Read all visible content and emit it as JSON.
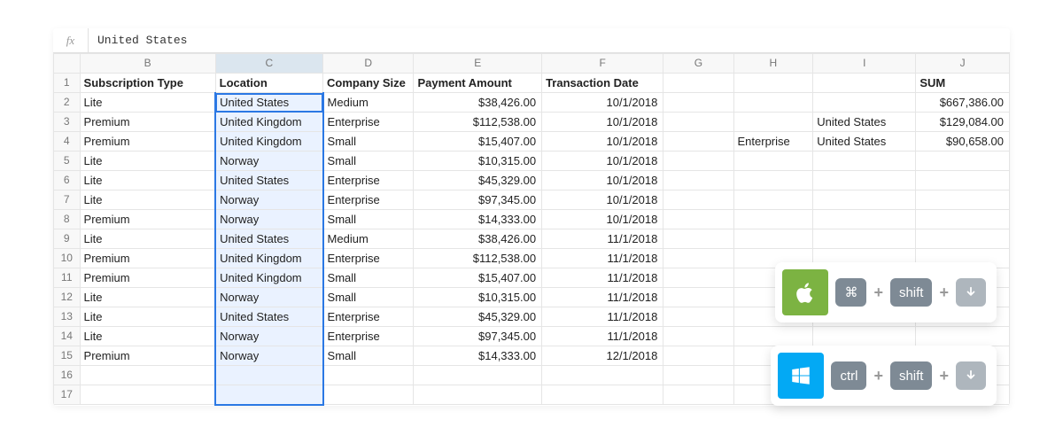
{
  "formula_bar": {
    "fx": "fx",
    "value": "United States"
  },
  "columns": [
    "B",
    "C",
    "D",
    "E",
    "F",
    "G",
    "H",
    "I",
    "J"
  ],
  "rownums": [
    "1",
    "2",
    "3",
    "4",
    "5",
    "6",
    "7",
    "8",
    "9",
    "10",
    "11",
    "12",
    "13",
    "14",
    "15",
    "16",
    "17"
  ],
  "headers": {
    "B": "Subscription Type",
    "C": "Location",
    "D": "Company Size",
    "E": "Payment Amount",
    "F": "Transaction Date",
    "G": "",
    "H": "",
    "I": "",
    "J": "SUM"
  },
  "rows": [
    {
      "B": "Lite",
      "C": "United States",
      "D": "Medium",
      "E": "$38,426.00",
      "F": "10/1/2018",
      "G": "",
      "H": "",
      "I": "",
      "J": "$667,386.00"
    },
    {
      "B": "Premium",
      "C": "United Kingdom",
      "D": "Enterprise",
      "E": "$112,538.00",
      "F": "10/1/2018",
      "G": "",
      "H": "",
      "I": "United States",
      "J": "$129,084.00"
    },
    {
      "B": "Premium",
      "C": "United Kingdom",
      "D": "Small",
      "E": "$15,407.00",
      "F": "10/1/2018",
      "G": "",
      "H": "Enterprise",
      "I": "United States",
      "J": "$90,658.00"
    },
    {
      "B": "Lite",
      "C": "Norway",
      "D": "Small",
      "E": "$10,315.00",
      "F": "10/1/2018",
      "G": "",
      "H": "",
      "I": "",
      "J": ""
    },
    {
      "B": "Lite",
      "C": "United States",
      "D": "Enterprise",
      "E": "$45,329.00",
      "F": "10/1/2018",
      "G": "",
      "H": "",
      "I": "",
      "J": ""
    },
    {
      "B": "Lite",
      "C": "Norway",
      "D": "Enterprise",
      "E": "$97,345.00",
      "F": "10/1/2018",
      "G": "",
      "H": "",
      "I": "",
      "J": ""
    },
    {
      "B": "Premium",
      "C": "Norway",
      "D": "Small",
      "E": "$14,333.00",
      "F": "10/1/2018",
      "G": "",
      "H": "",
      "I": "",
      "J": ""
    },
    {
      "B": "Lite",
      "C": "United States",
      "D": "Medium",
      "E": "$38,426.00",
      "F": "11/1/2018",
      "G": "",
      "H": "",
      "I": "",
      "J": ""
    },
    {
      "B": "Premium",
      "C": "United Kingdom",
      "D": "Enterprise",
      "E": "$112,538.00",
      "F": "11/1/2018",
      "G": "",
      "H": "",
      "I": "",
      "J": ""
    },
    {
      "B": "Premium",
      "C": "United Kingdom",
      "D": "Small",
      "E": "$15,407.00",
      "F": "11/1/2018",
      "G": "",
      "H": "",
      "I": "",
      "J": ""
    },
    {
      "B": "Lite",
      "C": "Norway",
      "D": "Small",
      "E": "$10,315.00",
      "F": "11/1/2018",
      "G": "",
      "H": "",
      "I": "",
      "J": ""
    },
    {
      "B": "Lite",
      "C": "United States",
      "D": "Enterprise",
      "E": "$45,329.00",
      "F": "11/1/2018",
      "G": "",
      "H": "",
      "I": "",
      "J": ""
    },
    {
      "B": "Lite",
      "C": "Norway",
      "D": "Enterprise",
      "E": "$97,345.00",
      "F": "11/1/2018",
      "G": "",
      "H": "",
      "I": "",
      "J": ""
    },
    {
      "B": "Premium",
      "C": "Norway",
      "D": "Small",
      "E": "$14,333.00",
      "F": "12/1/2018",
      "G": "",
      "H": "",
      "I": "",
      "J": ""
    }
  ],
  "shortcuts": {
    "mac": {
      "k1": "⌘",
      "k2": "shift",
      "k3": "↓"
    },
    "win": {
      "k1": "ctrl",
      "k2": "shift",
      "k3": "↓"
    },
    "plus": "+"
  }
}
